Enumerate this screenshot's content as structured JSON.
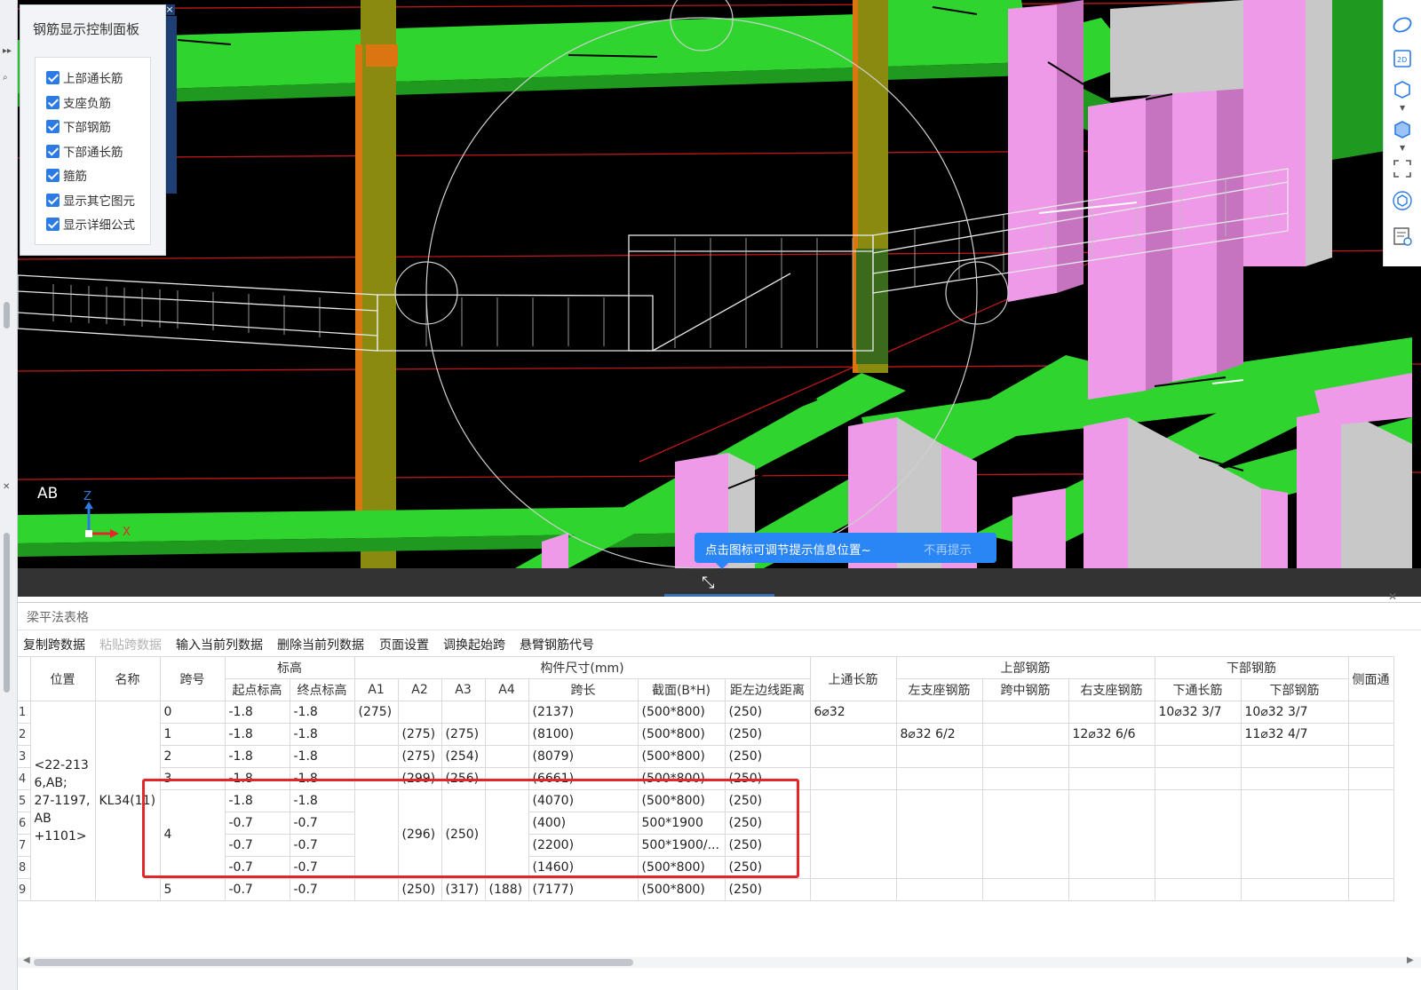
{
  "control_panel": {
    "title": "钢筋显示控制面板",
    "options": [
      {
        "label": "上部通长筋",
        "checked": true
      },
      {
        "label": "支座负筋",
        "checked": true
      },
      {
        "label": "下部钢筋",
        "checked": true
      },
      {
        "label": "下部通长筋",
        "checked": true
      },
      {
        "label": "箍筋",
        "checked": true
      },
      {
        "label": "显示其它图元",
        "checked": true
      },
      {
        "label": "显示详细公式",
        "checked": true
      }
    ]
  },
  "viewport": {
    "tooltip": {
      "text": "点击图标可调节提示信息位置~",
      "dismiss": "不再提示"
    },
    "ab_label": "AB",
    "axis": {
      "z": "Z",
      "x": "X"
    }
  },
  "right_toolbar": {
    "icons": [
      "orbit-icon",
      "2d-view-icon",
      "3d-box-icon",
      "3d-solid-box-icon",
      "fullscreen-icon",
      "view-cube-icon",
      "properties-icon"
    ],
    "view_2d_label": "2D"
  },
  "table_panel": {
    "title": "梁平法表格",
    "toolbar": [
      {
        "label": "复制跨数据",
        "enabled": true
      },
      {
        "label": "粘贴跨数据",
        "enabled": false
      },
      {
        "label": "输入当前列数据",
        "enabled": true
      },
      {
        "label": "删除当前列数据",
        "enabled": true
      },
      {
        "label": "页面设置",
        "enabled": true
      },
      {
        "label": "调换起始跨",
        "enabled": true
      },
      {
        "label": "悬臂钢筋代号",
        "enabled": true
      }
    ],
    "headers": {
      "position": "位置",
      "name": "名称",
      "span": "跨号",
      "elevation_group": "标高",
      "start_elev": "起点标高",
      "end_elev": "终点标高",
      "size_group": "构件尺寸(mm)",
      "a1": "A1",
      "a2": "A2",
      "a3": "A3",
      "a4": "A4",
      "span_len": "跨长",
      "section": "截面(B*H)",
      "dist": "距左边线距离",
      "top_through": "上通长筋",
      "top_group": "上部钢筋",
      "left_support": "左支座钢筋",
      "mid": "跨中钢筋",
      "right_support": "右支座钢筋",
      "bottom_group": "下部钢筋",
      "bot_through": "下通长筋",
      "bot_bar": "下部钢筋",
      "side": "侧面通"
    },
    "position_value": "<22-213 6,AB; 27-1197, AB +1101>",
    "name_value": "KL34(11)",
    "rows": [
      {
        "n": "1",
        "span": "0",
        "start": "-1.8",
        "end": "-1.8",
        "a1": "(275)",
        "a2": "",
        "a3": "",
        "a4": "",
        "len": "(2137)",
        "sec": "(500*800)",
        "dist": "(250)",
        "top": "6⌀32",
        "ls": "",
        "mid": "",
        "rs": "",
        "bt": "10⌀32 3/7",
        "bb": "10⌀32 3/7"
      },
      {
        "n": "2",
        "span": "1",
        "start": "-1.8",
        "end": "-1.8",
        "a1": "",
        "a2": "(275)",
        "a3": "(275)",
        "a4": "",
        "len": "(8100)",
        "sec": "(500*800)",
        "dist": "(250)",
        "top": "",
        "ls": "8⌀32 6/2",
        "mid": "",
        "rs": "12⌀32 6/6",
        "bt": "",
        "bb": "11⌀32 4/7"
      },
      {
        "n": "3",
        "span": "2",
        "start": "-1.8",
        "end": "-1.8",
        "a1": "",
        "a2": "(275)",
        "a3": "(254)",
        "a4": "",
        "len": "(8079)",
        "sec": "(500*800)",
        "dist": "(250)",
        "top": "",
        "ls": "",
        "mid": "",
        "rs": "",
        "bt": "",
        "bb": ""
      },
      {
        "n": "4",
        "span": "3",
        "start": "-1.8",
        "end": "-1.8",
        "a1": "",
        "a2": "(299)",
        "a3": "(256)",
        "a4": "",
        "len": "(6661)",
        "sec": "(500*800)",
        "dist": "(250)",
        "top": "",
        "ls": "",
        "mid": "",
        "rs": "",
        "bt": "",
        "bb": ""
      },
      {
        "n": "5",
        "span": "4",
        "start": "-1.8",
        "end": "-1.8",
        "a1": "",
        "a2": "(296)",
        "a3": "(250)",
        "a4": "",
        "len": "(4070)",
        "sec": "(500*800)",
        "dist": "(250)",
        "top": "",
        "ls": "",
        "mid": "",
        "rs": "",
        "bt": "",
        "bb": ""
      },
      {
        "n": "6",
        "span": "",
        "start": "-0.7",
        "end": "-0.7",
        "a1": "",
        "a2": "",
        "a3": "",
        "a4": "",
        "len": "(400)",
        "sec": "500*1900",
        "dist": "(250)",
        "top": "",
        "ls": "",
        "mid": "",
        "rs": "",
        "bt": "",
        "bb": ""
      },
      {
        "n": "7",
        "span": "",
        "start": "-0.7",
        "end": "-0.7",
        "a1": "",
        "a2": "",
        "a3": "",
        "a4": "",
        "len": "(2200)",
        "sec": "500*1900/...",
        "dist": "(250)",
        "top": "",
        "ls": "",
        "mid": "",
        "rs": "",
        "bt": "",
        "bb": ""
      },
      {
        "n": "8",
        "span": "",
        "start": "-0.7",
        "end": "-0.7",
        "a1": "",
        "a2": "",
        "a3": "",
        "a4": "",
        "len": "(1460)",
        "sec": "(500*800)",
        "dist": "(250)",
        "top": "",
        "ls": "",
        "mid": "",
        "rs": "",
        "bt": "",
        "bb": ""
      },
      {
        "n": "9",
        "span": "5",
        "start": "-0.7",
        "end": "-0.7",
        "a1": "",
        "a2": "(250)",
        "a3": "(317)",
        "a4": "(188)",
        "len": "(7177)",
        "sec": "(500*800)",
        "dist": "(250)",
        "top": "",
        "ls": "",
        "mid": "",
        "rs": "",
        "bt": "",
        "bb": ""
      }
    ]
  },
  "colors": {
    "beam_green": "#2fd42f",
    "column_pink": "#ee9ae8",
    "column_grey": "#c8c8c8",
    "column_olive": "#8a8a10",
    "column_orange": "#d9760f",
    "highlight_red": "#e4262a",
    "accent_blue": "#2b86f5"
  }
}
